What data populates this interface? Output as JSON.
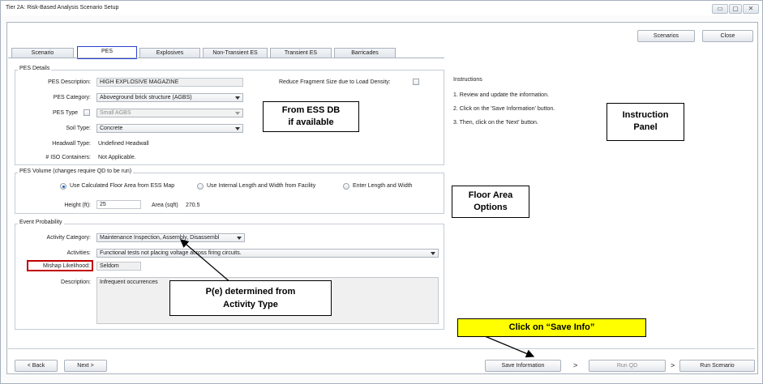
{
  "window": {
    "title": "Tier 2A: Risk-Based Analysis Scenario Setup",
    "minimize": "▭",
    "restore": "▢",
    "close": "✕"
  },
  "toolbar": {
    "scenarios": "Scenarios",
    "close": "Close"
  },
  "tabs": [
    "Scenario",
    "PES",
    "Explosives",
    "Non-Transient ES",
    "Transient ES",
    "Barricades"
  ],
  "active_tab": "PES",
  "pes_details": {
    "title": "PES Details",
    "description_label": "PES Description:",
    "description_value": "HIGH EXPLOSIVE MAGAZINE",
    "reduce_label": "Reduce Fragment Size due to Load Density:",
    "category_label": "PES Category:",
    "category_value": "Aboveground brick structure (AGBS)",
    "type_label": "PES Type",
    "type_value": "Small AGBS",
    "soil_label": "Soil Type:",
    "soil_value": "Concrete",
    "headwall_label": "Headwall Type:",
    "headwall_value": "Undefined Headwall",
    "iso_label": "# ISO Containers:",
    "iso_value": "Not Applicable."
  },
  "pes_volume": {
    "title": "PES Volume (changes require QD to be run)",
    "options": [
      "Use Calculated Floor Area from ESS Map",
      "Use Internal Length and Width from Facility",
      "Enter Length and Width"
    ],
    "height_label": "Height (ft):",
    "height_value": "25",
    "area_label": "Area (sqft)",
    "area_value": "270.5"
  },
  "event_probability": {
    "title": "Event Probability",
    "activity_category_label": "Activity Category:",
    "activity_category_value": "Maintenance Inspection, Assembly, Disassembl",
    "activities_label": "Activities:",
    "activities_value": "Functional tests not placing voltage across firing circuits.",
    "mishap_label": "Mishap Likelihood:",
    "mishap_value": "Seldom",
    "description_label": "Description:",
    "description_value": "Infrequent occurrences"
  },
  "instructions": {
    "title": "Instructions",
    "steps": [
      "1. Review and update the information.",
      "2. Click on the 'Save Information' button.",
      "3. Then, click on the 'Next' button."
    ]
  },
  "annotations": {
    "ess_db_line1": "From ESS DB",
    "ess_db_line2": "if available",
    "instruction_line1": "Instruction",
    "instruction_line2": "Panel",
    "floor_line1": "Floor Area",
    "floor_line2": "Options",
    "pe_line1": "P(e) determined from",
    "pe_line2": "Activity Type",
    "save_info": "Click on “Save Info”"
  },
  "footer": {
    "back": "<  Back",
    "next": "Next  >",
    "save_information": "Save Information",
    "sep1": ">",
    "run_qd": "Run QD",
    "sep2": ">",
    "run_scenario": "Run Scenario"
  },
  "colors": {
    "highlight_red": "#c00000",
    "tab_highlight_blue": "#2a3fd6",
    "callout_yellow": "#ffff00"
  }
}
